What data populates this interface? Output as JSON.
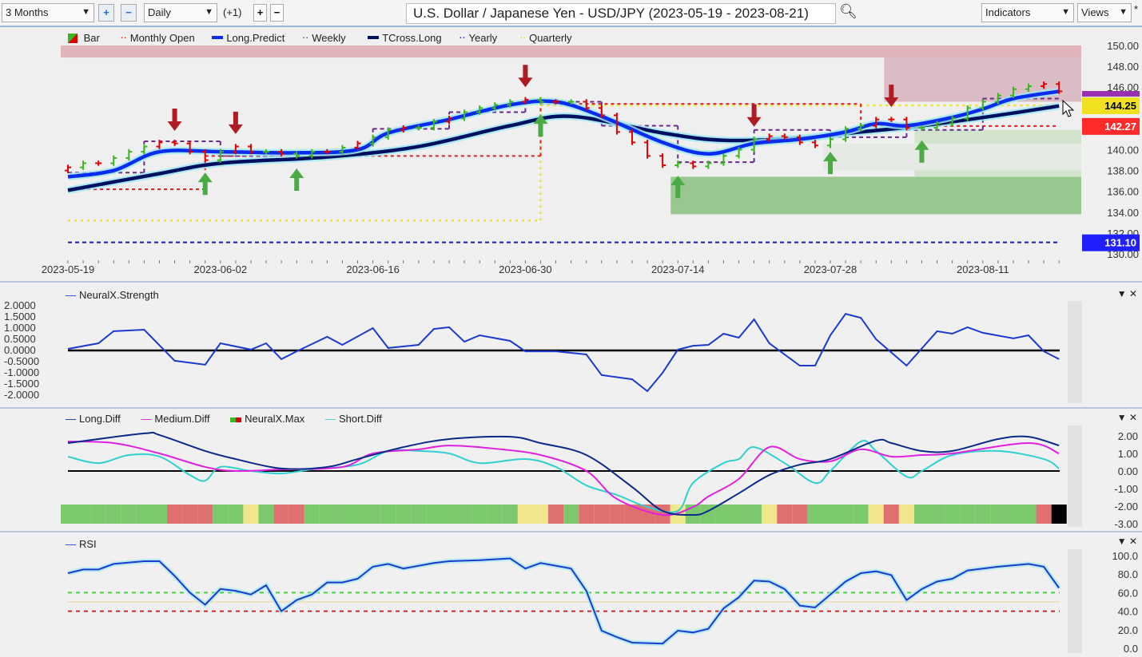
{
  "toolbar": {
    "period": "3 Months",
    "interval": "Daily",
    "offset": "(+1)",
    "title": "U.S. Dollar / Japanese Yen - USD/JPY (2023-05-19 - 2023-08-21)",
    "indicators": "Indicators",
    "views": "Views"
  },
  "legend_price": [
    "Bar",
    "Monthly Open",
    "Long.Predict",
    "Weekly",
    "TCross.Long",
    "Yearly",
    "Quarterly"
  ],
  "legend_strength": [
    "NeuralX.Strength"
  ],
  "legend_diff": [
    "Long.Diff",
    "Medium.Diff",
    "NeuralX.Max",
    "Short.Diff"
  ],
  "legend_rsi": [
    "RSI"
  ],
  "colors": {
    "up": "#3cb521",
    "down": "#e00000",
    "long_predict": "#0a2cf0",
    "tcross": "#001060",
    "weekly": "#6a2a8a",
    "monthly": "#e02020",
    "yearly": "#1a1ab0",
    "quarterly": "#f0e020",
    "long_diff": "#0a2a8a",
    "medium_diff": "#e020e0",
    "short_diff": "#30d0d0",
    "rsi": "#1a3ad0"
  },
  "chart_data": [
    {
      "type": "ohlc",
      "name": "price",
      "x_ticks": [
        "2023-05-19",
        "2023-06-02",
        "2023-06-16",
        "2023-06-30",
        "2023-07-14",
        "2023-07-28",
        "2023-08-11"
      ],
      "y_ticks": [
        "150.00",
        "148.00",
        "146.00",
        "144.00",
        "142.00",
        "140.00",
        "138.00",
        "136.00",
        "134.00",
        "132.00",
        "130.00"
      ],
      "ylim": [
        130,
        150
      ],
      "closes": [
        138.3,
        138.7,
        138.7,
        139.2,
        139.8,
        140.3,
        140.7,
        140.6,
        139.8,
        139.0,
        139.8,
        140.3,
        139.8,
        139.8,
        139.6,
        139.4,
        139.8,
        139.8,
        140.2,
        140.6,
        141.2,
        141.9,
        142.1,
        142.1,
        142.7,
        143.0,
        143.6,
        144.0,
        144.3,
        144.6,
        144.8,
        144.6,
        144.6,
        144.6,
        144.0,
        143.3,
        141.7,
        140.7,
        139.4,
        138.5,
        138.7,
        138.4,
        138.7,
        139.4,
        140.0,
        141.0,
        141.3,
        141.2,
        140.7,
        140.4,
        141.0,
        142.0,
        142.3,
        142.9,
        142.9,
        142.1,
        142.1,
        142.5,
        143.0,
        144.0,
        144.6,
        145.2,
        145.8,
        146.1,
        146.3,
        145.6
      ],
      "bar_colors": "rgrgggrrrrgrrgrggrgrggrggrggggrgrgrrrrrrgrggggrrrrgggrrrggggggggrr",
      "long_predict": [
        137.4,
        null,
        null,
        138.0,
        null,
        null,
        139.8,
        null,
        null,
        null,
        139.8,
        null,
        null,
        null,
        null,
        139.7,
        null,
        null,
        null,
        140.0,
        null,
        141.6,
        null,
        null,
        null,
        142.9,
        null,
        null,
        null,
        144.3,
        null,
        null,
        144.6,
        null,
        null,
        143.2,
        null,
        null,
        null,
        140.7,
        null,
        null,
        139.6,
        null,
        null,
        140.6,
        null,
        null,
        141.0,
        null,
        null,
        141.7,
        null,
        142.5,
        null,
        142.3,
        null,
        null,
        143.1,
        null,
        143.9,
        null,
        144.9,
        null,
        null,
        145.6
      ],
      "tcross_long": [
        136.1,
        null,
        null,
        null,
        null,
        null,
        137.7,
        null,
        null,
        null,
        138.7,
        null,
        null,
        null,
        null,
        null,
        null,
        139.3,
        null,
        null,
        null,
        null,
        null,
        140.3,
        null,
        null,
        null,
        null,
        null,
        142.3,
        null,
        null,
        null,
        143.2,
        null,
        null,
        null,
        null,
        null,
        141.6,
        null,
        null,
        null,
        140.9,
        null,
        null,
        null,
        null,
        141.1,
        null,
        null,
        null,
        141.7,
        null,
        null,
        null,
        142.3,
        null,
        null,
        null,
        null,
        143.3,
        null,
        null,
        null,
        144.2
      ],
      "weekly": [
        {
          "from": "2023-05-19",
          "level": 137.8
        },
        {
          "from": "2023-05-26",
          "level": 140.8
        },
        {
          "from": "2023-06-02",
          "level": 139.4
        },
        {
          "from": "2023-06-09",
          "level": 139.6
        },
        {
          "from": "2023-06-16",
          "level": 142.0
        },
        {
          "from": "2023-06-23",
          "level": 143.6
        },
        {
          "from": "2023-06-30",
          "level": 144.6
        },
        {
          "from": "2023-07-07",
          "level": 142.3
        },
        {
          "from": "2023-07-14",
          "level": 138.8
        },
        {
          "from": "2023-07-21",
          "level": 141.9
        },
        {
          "from": "2023-07-28",
          "level": 141.2
        },
        {
          "from": "2023-08-04",
          "level": 141.9
        },
        {
          "from": "2023-08-11",
          "level": 144.9
        }
      ],
      "monthly_open": [
        {
          "from": "2023-05-19",
          "level": 136.2
        },
        {
          "from": "2023-06-01",
          "level": 139.4
        },
        {
          "from": "2023-07-03",
          "level": 144.4
        },
        {
          "from": "2023-08-01",
          "level": 142.27
        }
      ],
      "quarterly": [
        {
          "from": "2023-05-19",
          "level": 133.2
        },
        {
          "from": "2023-07-03",
          "level": 144.25
        }
      ],
      "yearly": 131.1,
      "signals": [
        {
          "date": "2023-05-30",
          "dir": "down"
        },
        {
          "date": "2023-06-05",
          "dir": "down"
        },
        {
          "date": "2023-06-30",
          "dir": "down"
        },
        {
          "date": "2023-07-21",
          "dir": "down"
        },
        {
          "date": "2023-08-03",
          "dir": "down"
        },
        {
          "date": "2023-06-01",
          "dir": "up"
        },
        {
          "date": "2023-06-09",
          "dir": "up"
        },
        {
          "date": "2023-07-03",
          "dir": "up"
        },
        {
          "date": "2023-07-14",
          "dir": "up"
        },
        {
          "date": "2023-07-28",
          "dir": "up"
        },
        {
          "date": "2023-08-07",
          "dir": "up"
        }
      ],
      "zones": [
        {
          "from": "2023-05-19",
          "top": 150,
          "bottom": 148.85,
          "color": "#e0b4b8"
        },
        {
          "from": "2023-08-03",
          "top": 148.85,
          "bottom": 144.6,
          "color": "#dcbcc4"
        },
        {
          "from": "2023-07-14",
          "top": 137.4,
          "bottom": 133.8,
          "color": "#98c890"
        },
        {
          "from": "2023-08-07",
          "top": 141.9,
          "bottom": 137.4,
          "color": "#d2e4cc"
        },
        {
          "from": "2023-07-28",
          "top": 140.6,
          "bottom": 138.0,
          "color": "#e6eae4"
        }
      ],
      "price_labels": [
        {
          "text": "144.25",
          "color": "#f0e020"
        },
        {
          "text": "142.27",
          "color": "#ff2a2a"
        },
        {
          "text": "131.10",
          "color": "#2020ff"
        }
      ]
    },
    {
      "type": "line",
      "name": "NeuralX.Strength",
      "ylim": [
        -2,
        2
      ],
      "y_ticks": [
        "2.0000",
        "1.5000",
        "1.0000",
        "0.5000",
        "0.0000",
        "-0.5000",
        "-1.0000",
        "-1.5000",
        "-2.0000"
      ],
      "values": [
        0.07,
        null,
        0.32,
        0.86,
        null,
        0.93,
        null,
        -0.46,
        null,
        -0.64,
        0.32,
        null,
        0.04,
        0.32,
        -0.39,
        -0.04,
        null,
        0.61,
        0.25,
        null,
        1.0,
        0.11,
        null,
        0.25,
        0.96,
        1.04,
        0.39,
        0.68,
        null,
        0.43,
        -0.04,
        null,
        -0.04,
        null,
        -0.18,
        -1.1,
        null,
        -1.29,
        -1.82,
        -1.0,
        0.04,
        0.21,
        0.25,
        0.75,
        0.57,
        1.39,
        0.32,
        null,
        -0.68,
        -0.68,
        0.68,
        1.64,
        1.46,
        0.5,
        null,
        -0.68,
        null,
        0.86,
        0.75,
        1.04,
        0.79,
        null,
        0.54,
        0.68,
        -0.04,
        -0.39
      ]
    },
    {
      "type": "line",
      "name": "diff",
      "ylim": [
        -3,
        2
      ],
      "y_ticks": [
        "2.00",
        "1.00",
        "0.00",
        "-1.00",
        "-2.00",
        "-3.00"
      ],
      "series": [
        {
          "name": "Long.Diff",
          "values": [
            1.59,
            null,
            null,
            null,
            null,
            2.14,
            2.05,
            null,
            null,
            1.14,
            null,
            0.68,
            null,
            null,
            0.14,
            null,
            null,
            0.23,
            null,
            0.68,
            null,
            null,
            1.36,
            null,
            null,
            1.82,
            null,
            null,
            null,
            1.95,
            null,
            1.59,
            null,
            null,
            0.91,
            null,
            null,
            -0.91,
            null,
            -2.27,
            null,
            -2.5,
            -2.27,
            null,
            -1.27,
            null,
            -0.23,
            null,
            0.36,
            null,
            0.68,
            null,
            null,
            1.73,
            1.59,
            null,
            1.14,
            null,
            1.14,
            null,
            null,
            1.82,
            null,
            1.95,
            null,
            1.45
          ]
        },
        {
          "name": "Medium.Diff",
          "values": [
            1.68,
            null,
            null,
            1.59,
            null,
            null,
            1.0,
            null,
            null,
            0.23,
            null,
            0,
            null,
            null,
            0.09,
            null,
            null,
            null,
            0.23,
            null,
            1.0,
            null,
            null,
            1.23,
            null,
            1.45,
            null,
            null,
            1.27,
            null,
            null,
            0.91,
            null,
            null,
            0,
            null,
            -1.59,
            null,
            null,
            -2.5,
            null,
            -2.05,
            -1.45,
            null,
            -0.45,
            null,
            1.36,
            null,
            0.68,
            null,
            0.55,
            null,
            1.23,
            null,
            0.82,
            null,
            0.91,
            null,
            1.0,
            null,
            null,
            null,
            null,
            1.59,
            null,
            1.0
          ]
        },
        {
          "name": "Short.Diff",
          "values": [
            0.82,
            null,
            0.45,
            null,
            0.91,
            null,
            0.82,
            null,
            -0.23,
            -0.55,
            0.23,
            null,
            0,
            null,
            -0.14,
            null,
            0.09,
            null,
            null,
            0.36,
            null,
            1.14,
            null,
            1.14,
            null,
            1.0,
            null,
            0.45,
            null,
            null,
            0.68,
            null,
            0.23,
            null,
            -0.82,
            null,
            -1.36,
            null,
            -2.05,
            null,
            -2.27,
            -0.68,
            null,
            0.45,
            0.68,
            1.36,
            null,
            0.45,
            null,
            -0.68,
            0,
            null,
            1.68,
            1.14,
            null,
            -0.32,
            0,
            null,
            0.91,
            null,
            null,
            1.14,
            null,
            null,
            0.68,
            0.14
          ]
        }
      ],
      "neuralx_max_states": "gggggggrrrggygrrggggggggggggggyyrgrrrrrrygggggyrrggggyryggggggggr"
    },
    {
      "type": "line",
      "name": "RSI",
      "ylim": [
        0,
        100
      ],
      "y_ticks": [
        "100.0",
        "80.0",
        "60.0",
        "40.0",
        "20.0",
        "0.0"
      ],
      "levels": [
        60,
        50,
        40
      ],
      "values": [
        81,
        85,
        85,
        91,
        null,
        94,
        94,
        78,
        60,
        47,
        64,
        62,
        58,
        68,
        40,
        52,
        58,
        71,
        71,
        75,
        88,
        91,
        86,
        null,
        92,
        94,
        null,
        95,
        null,
        97,
        86,
        92,
        null,
        86,
        62,
        19,
        12,
        6,
        null,
        5,
        19,
        17,
        21,
        43,
        55,
        73,
        72,
        64,
        46,
        44,
        58,
        72,
        81,
        83,
        79,
        52,
        64,
        72,
        75,
        84,
        null,
        88,
        null,
        91,
        88,
        65
      ]
    }
  ]
}
